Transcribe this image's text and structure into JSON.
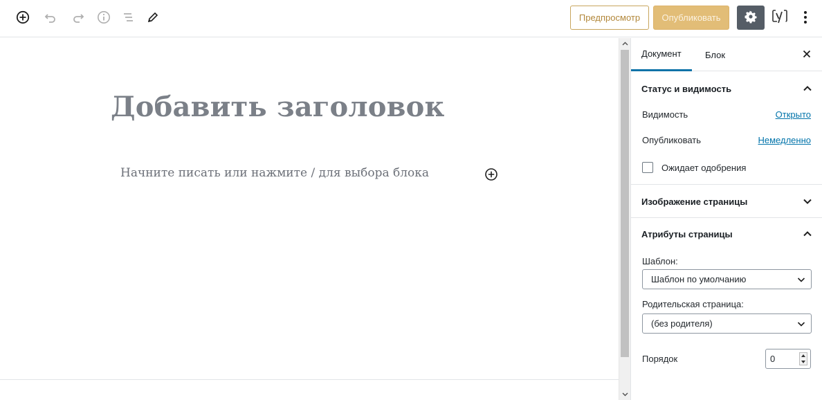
{
  "toolbar": {
    "icons": [
      "add-block-icon",
      "undo-icon",
      "redo-icon",
      "info-icon",
      "block-navigation-icon",
      "edit-tools-icon"
    ],
    "preview_label": "Предпросмотр",
    "publish_label": "Опубликовать",
    "settings_icon": "gear-icon",
    "plugin_icon": "yoast-icon",
    "more_icon": "more-vertical-icon"
  },
  "editor": {
    "title_placeholder": "Добавить заголовок",
    "block_placeholder": "Начните писать или нажмите / для выбора блока"
  },
  "sidebar": {
    "tabs": [
      {
        "label": "Документ",
        "active": true
      },
      {
        "label": "Блок",
        "active": false
      }
    ],
    "status_panel": {
      "title": "Статус и видимость",
      "visibility_label": "Видимость",
      "visibility_value": "Открыто",
      "publish_label": "Опубликовать",
      "publish_value": "Немедленно",
      "pending_review_label": "Ожидает одобрения",
      "pending_review_checked": false
    },
    "featured_image_panel": {
      "title": "Изображение страницы"
    },
    "page_attributes_panel": {
      "title": "Атрибуты страницы",
      "template_label": "Шаблон:",
      "template_value": "Шаблон по умолчанию",
      "parent_label": "Родительская страница:",
      "parent_value": "(без родителя)",
      "order_label": "Порядок",
      "order_value": "0"
    }
  },
  "colors": {
    "accent": "#0073aa",
    "tab_active": "#0d73a8",
    "publish_bg": "#e2bd77",
    "preview_border": "#c7a55d",
    "settings_bg": "#555d66"
  }
}
